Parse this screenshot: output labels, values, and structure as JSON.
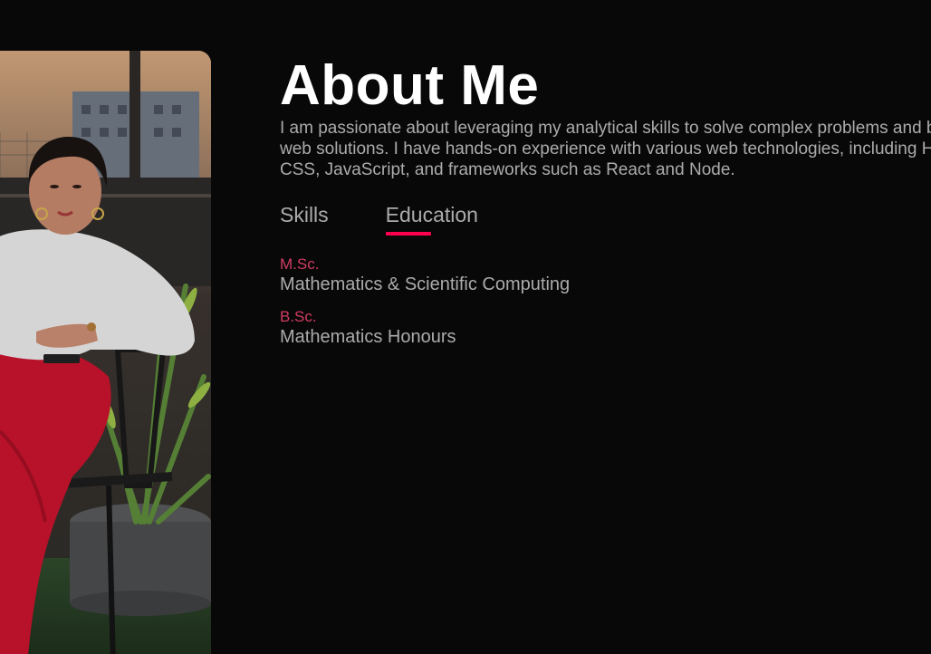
{
  "about": {
    "title": "About Me",
    "intro": "I am passionate about leveraging my analytical skills to solve complex problems and build web solutions. I have hands-on experience with various web technologies, including HTML, CSS, JavaScript, and frameworks such as React and Node."
  },
  "tabs": [
    {
      "label": "Skills",
      "active": false
    },
    {
      "label": "Education",
      "active": true
    }
  ],
  "education": [
    {
      "degree": "M.Sc.",
      "field": "Mathematics & Scientific Computing"
    },
    {
      "degree": "B.Sc.",
      "field": "Mathematics Honours"
    }
  ],
  "colors": {
    "background": "#080808",
    "accent": "#ff004f",
    "degree": "#d13c63",
    "text": "#ababab",
    "title": "#ffffff"
  }
}
